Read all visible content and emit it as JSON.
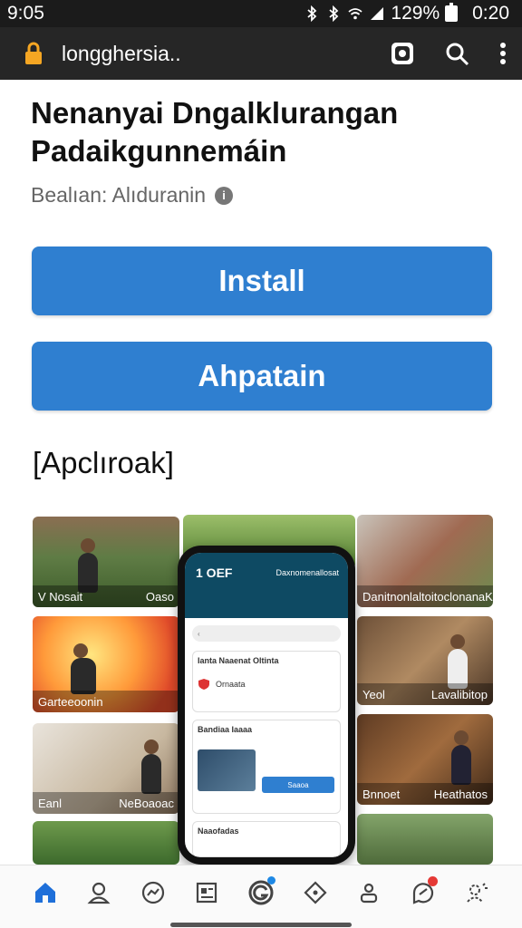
{
  "status_bar": {
    "time_left": "9:05",
    "battery_percent": "129%",
    "time_right": "0:20",
    "icons": [
      "bluetooth-icon",
      "bluetooth-icon",
      "wifi-icon",
      "signal-icon",
      "battery-icon"
    ]
  },
  "browser": {
    "url": "longghersia..",
    "actions": [
      "tab-switcher-icon",
      "search-icon",
      "more-vert-icon"
    ]
  },
  "app": {
    "title": "Nenanyai Dngalklurangan Padaikgunnemáin",
    "subtitle": "Bealıan: Alıduranin",
    "install_label": "Install",
    "secondary_label": "Ahpatain",
    "section_title": "[Apclıroak]"
  },
  "gallery": {
    "tiles": [
      {
        "left": "V Nosait",
        "right": "Oaso"
      },
      {
        "left": "",
        "right": ""
      },
      {
        "left": "Danitnonlaltoitoclonana",
        "right": "K"
      },
      {
        "left": "Garteeoonin",
        "right": ""
      },
      {
        "left": "Yeol",
        "right": "Lavalibitop"
      },
      {
        "left": "Eanl",
        "right": "NeBoaoac"
      },
      {
        "left": "Bnnoet",
        "right": "Heathatos"
      }
    ]
  },
  "phone_mockup": {
    "header_title": "1 OEF",
    "header_sub": "Daxnomenallosat",
    "card1_title": "Ianta Naaenat Oltinta",
    "card1_line": "Ornaata",
    "card2_title": "Bandiaa Iaaaa",
    "card2_button": "Saaoa",
    "card3_title": "Naaofadas"
  },
  "bottom_nav": {
    "items": [
      "home-icon",
      "profile-icon",
      "messenger-icon",
      "news-icon",
      "groups-icon",
      "tag-icon",
      "people-icon",
      "chat-icon",
      "assistant-icon"
    ],
    "badge_colors": {
      "groups": "#1e88e5",
      "chat": "#e53935"
    }
  },
  "colors": {
    "accent": "#2f7fd0",
    "browser_bar": "#262626",
    "lock": "#f5a623"
  }
}
